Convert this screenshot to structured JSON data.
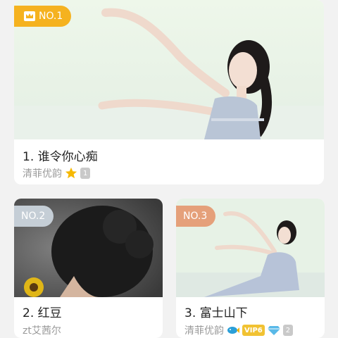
{
  "cards": [
    {
      "rank": "NO.1",
      "title": "1. 谁令你心痴",
      "author": "清菲优韵",
      "level": "1"
    },
    {
      "rank": "NO.2",
      "title": "2. 红豆",
      "author": "zt艾茜尔"
    },
    {
      "rank": "NO.3",
      "title": "3. 富士山下",
      "author": "清菲优韵",
      "vip": "VIP6",
      "level": "2"
    }
  ],
  "colors": {
    "rank1": "#f5b21f",
    "rank2": "#c5ced6",
    "rank3": "#e5a07a"
  },
  "icons": [
    "crown-icon",
    "star-icon",
    "fish-icon",
    "diamond-icon"
  ]
}
